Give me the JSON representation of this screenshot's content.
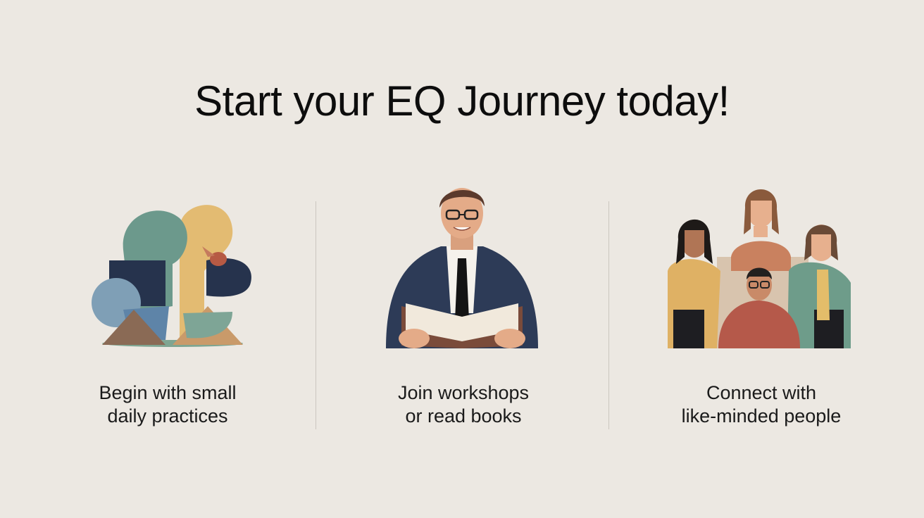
{
  "slide": {
    "title": "Start your EQ Journey today!",
    "columns": [
      {
        "caption_line1": "Begin with small",
        "caption_line2": "daily practices",
        "illustration": "abstract-shapes-illustration"
      },
      {
        "caption_line1": "Join workshops",
        "caption_line2": "or read books",
        "illustration": "man-reading-book-illustration"
      },
      {
        "caption_line1": "Connect with",
        "caption_line2": "like-minded people",
        "illustration": "group-of-people-illustration"
      }
    ]
  },
  "colors": {
    "background": "#ece8e2",
    "text": "#111111",
    "divider": "#cbc6bf",
    "teal": "#6b968a",
    "mustard": "#e2b86a",
    "navy": "#26334d",
    "rust": "#b5594a"
  }
}
